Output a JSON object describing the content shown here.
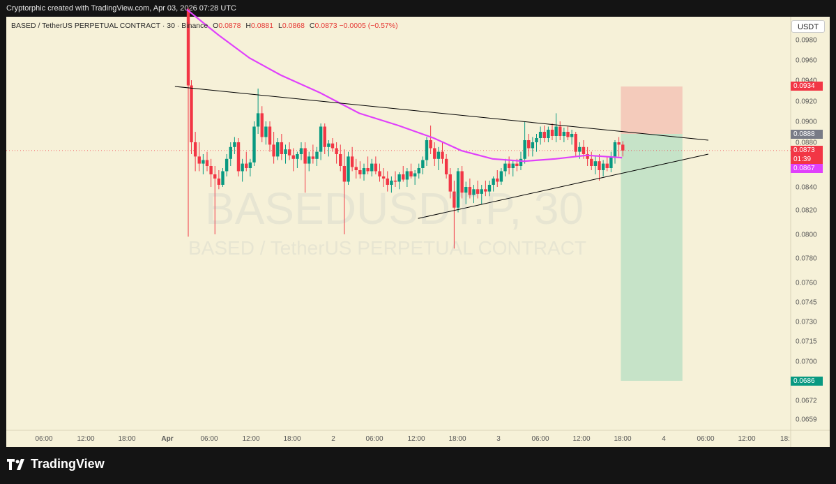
{
  "header": {
    "attribution": "Cryptorphic created with TradingView.com, Apr 03, 2026 07:28 UTC"
  },
  "legend": {
    "symbol": "BASED / TetherUS PERPETUAL CONTRACT · 30 · Binance",
    "o_label": "O",
    "o_value": "0.0878",
    "h_label": "H",
    "h_value": "0.0881",
    "l_label": "L",
    "l_value": "0.0868",
    "c_label": "C",
    "c_value": "0.0873",
    "change": "−0.0005 (−0.57%)"
  },
  "watermark": {
    "ticker": "BASEDUSDT.P, 30",
    "name": "BASED / TetherUS PERPETUAL CONTRACT"
  },
  "currency_button": "USDT",
  "price_tags": {
    "stop": {
      "text": "0.0934",
      "color": "#f23645"
    },
    "entry": {
      "text": "0.0888",
      "color": "#787b86"
    },
    "last": {
      "text": "0.0873",
      "color": "#f23645"
    },
    "countdown": {
      "text": "01:39",
      "color": "#f23645"
    },
    "ma": {
      "text": "0.0867",
      "color": "#e040fb"
    },
    "target": {
      "text": "0.0686",
      "color": "#089981"
    }
  },
  "brand": {
    "name": "TradingView"
  },
  "chart_data": {
    "type": "candlestick",
    "interval": "30",
    "yaxis_ticks": [
      "0.0980",
      "0.0960",
      "0.0940",
      "0.0920",
      "0.0900",
      "0.0880",
      "0.0860",
      "0.0840",
      "0.0820",
      "0.0800",
      "0.0780",
      "0.0760",
      "0.0745",
      "0.0730",
      "0.0715",
      "0.0700",
      "0.0672",
      "0.0659"
    ],
    "xaxis_ticks": [
      "06:00",
      "12:00",
      "18:00",
      "Apr",
      "06:00",
      "12:00",
      "18:00",
      "2",
      "06:00",
      "12:00",
      "18:00",
      "3",
      "06:00",
      "12:00",
      "18:00",
      "4",
      "06:00",
      "12:00",
      "18:"
    ],
    "colors": {
      "up": "#089981",
      "down": "#f23645",
      "ma": "#e040fb",
      "trendline": "#000000",
      "profit_zone": "#c6e3c8",
      "loss_zone": "#f4cbbb"
    },
    "ma_line": [
      [
        0.23,
        0.101
      ],
      [
        0.27,
        0.0985
      ],
      [
        0.31,
        0.0962
      ],
      [
        0.35,
        0.0945
      ],
      [
        0.4,
        0.0928
      ],
      [
        0.45,
        0.0908
      ],
      [
        0.5,
        0.0896
      ],
      [
        0.545,
        0.0884
      ],
      [
        0.58,
        0.0873
      ],
      [
        0.62,
        0.0866
      ],
      [
        0.66,
        0.0864
      ],
      [
        0.7,
        0.0866
      ],
      [
        0.74,
        0.0869
      ],
      [
        0.785,
        0.0867
      ]
    ],
    "trendline_upper": {
      "from": [
        0.215,
        0.0934
      ],
      "to": [
        0.895,
        0.0882
      ]
    },
    "trendline_lower": {
      "from": [
        0.525,
        0.0813
      ],
      "to": [
        0.895,
        0.087
      ]
    },
    "position": {
      "type": "long",
      "entry": 0.0888,
      "stop": 0.0934,
      "target": 0.0686
    },
    "candles": [
      [
        0.232,
        0.101,
        0.1012,
        0.0798,
        0.0935
      ],
      [
        0.236,
        0.0935,
        0.094,
        0.087,
        0.088
      ],
      [
        0.241,
        0.088,
        0.089,
        0.0855,
        0.0868
      ],
      [
        0.246,
        0.0868,
        0.088,
        0.0855,
        0.0862
      ],
      [
        0.251,
        0.0862,
        0.087,
        0.0852,
        0.0865
      ],
      [
        0.256,
        0.0865,
        0.0872,
        0.0855,
        0.086
      ],
      [
        0.261,
        0.086,
        0.0866,
        0.084,
        0.0852
      ],
      [
        0.266,
        0.0852,
        0.086,
        0.08,
        0.0848
      ],
      [
        0.271,
        0.0848,
        0.0856,
        0.0838,
        0.0842
      ],
      [
        0.276,
        0.0842,
        0.0858,
        0.084,
        0.0855
      ],
      [
        0.281,
        0.0855,
        0.087,
        0.085,
        0.0866
      ],
      [
        0.286,
        0.0866,
        0.088,
        0.086,
        0.0876
      ],
      [
        0.291,
        0.0876,
        0.0885,
        0.087,
        0.088
      ],
      [
        0.296,
        0.088,
        0.0884,
        0.085,
        0.0855
      ],
      [
        0.301,
        0.0855,
        0.0866,
        0.0845,
        0.0862
      ],
      [
        0.306,
        0.0862,
        0.0872,
        0.0855,
        0.0858
      ],
      [
        0.311,
        0.0858,
        0.0866,
        0.085,
        0.0863
      ],
      [
        0.316,
        0.0863,
        0.09,
        0.086,
        0.0895
      ],
      [
        0.321,
        0.0895,
        0.0932,
        0.0888,
        0.0908
      ],
      [
        0.326,
        0.0908,
        0.0915,
        0.088,
        0.0885
      ],
      [
        0.331,
        0.0885,
        0.09,
        0.0878,
        0.0895
      ],
      [
        0.336,
        0.0895,
        0.09,
        0.0872,
        0.0878
      ],
      [
        0.341,
        0.0878,
        0.089,
        0.0862,
        0.0868
      ],
      [
        0.346,
        0.0868,
        0.0884,
        0.0865,
        0.088
      ],
      [
        0.351,
        0.088,
        0.0888,
        0.0865,
        0.087
      ],
      [
        0.356,
        0.087,
        0.0878,
        0.0862,
        0.0874
      ],
      [
        0.361,
        0.0874,
        0.088,
        0.0865,
        0.0869
      ],
      [
        0.366,
        0.0869,
        0.0875,
        0.0855,
        0.0866
      ],
      [
        0.371,
        0.0866,
        0.0872,
        0.0858,
        0.087
      ],
      [
        0.376,
        0.087,
        0.088,
        0.0865,
        0.0875
      ],
      [
        0.381,
        0.0875,
        0.088,
        0.0835,
        0.0862
      ],
      [
        0.386,
        0.0862,
        0.0872,
        0.0855,
        0.0868
      ],
      [
        0.391,
        0.0868,
        0.0878,
        0.0862,
        0.0866
      ],
      [
        0.396,
        0.0866,
        0.0876,
        0.086,
        0.0872
      ],
      [
        0.401,
        0.0872,
        0.0898,
        0.0865,
        0.0895
      ],
      [
        0.406,
        0.0895,
        0.0898,
        0.087,
        0.0876
      ],
      [
        0.411,
        0.0876,
        0.0882,
        0.0868,
        0.0879
      ],
      [
        0.416,
        0.0879,
        0.0884,
        0.0872,
        0.0875
      ],
      [
        0.421,
        0.0875,
        0.088,
        0.0862,
        0.087
      ],
      [
        0.426,
        0.087,
        0.0878,
        0.0855,
        0.086
      ],
      [
        0.431,
        0.086,
        0.0874,
        0.08,
        0.0845
      ],
      [
        0.436,
        0.0845,
        0.0872,
        0.0842,
        0.0868
      ],
      [
        0.441,
        0.0868,
        0.0876,
        0.0855,
        0.0859
      ],
      [
        0.446,
        0.0859,
        0.0866,
        0.0848,
        0.0856
      ],
      [
        0.451,
        0.0856,
        0.0864,
        0.0848,
        0.0852
      ],
      [
        0.456,
        0.0852,
        0.0862,
        0.0846,
        0.0858
      ],
      [
        0.461,
        0.0858,
        0.0868,
        0.0852,
        0.0855
      ],
      [
        0.466,
        0.0855,
        0.0866,
        0.085,
        0.0862
      ],
      [
        0.471,
        0.0862,
        0.0868,
        0.0852,
        0.0855
      ],
      [
        0.476,
        0.0855,
        0.0862,
        0.0845,
        0.085
      ],
      [
        0.481,
        0.085,
        0.0858,
        0.084,
        0.0848
      ],
      [
        0.486,
        0.0848,
        0.0855,
        0.0836,
        0.0842
      ],
      [
        0.491,
        0.0842,
        0.085,
        0.0835,
        0.0846
      ],
      [
        0.496,
        0.0846,
        0.0855,
        0.084,
        0.0845
      ],
      [
        0.501,
        0.0845,
        0.0854,
        0.0838,
        0.0852
      ],
      [
        0.506,
        0.0852,
        0.086,
        0.0845,
        0.0847
      ],
      [
        0.511,
        0.0847,
        0.0858,
        0.084,
        0.0855
      ],
      [
        0.516,
        0.0855,
        0.0862,
        0.0848,
        0.085
      ],
      [
        0.521,
        0.085,
        0.0856,
        0.0842,
        0.0853
      ],
      [
        0.526,
        0.0853,
        0.0862,
        0.0848,
        0.0858
      ],
      [
        0.531,
        0.0858,
        0.0868,
        0.0852,
        0.0865
      ],
      [
        0.536,
        0.0865,
        0.0885,
        0.086,
        0.0882
      ],
      [
        0.541,
        0.0882,
        0.0896,
        0.087,
        0.0875
      ],
      [
        0.546,
        0.0875,
        0.088,
        0.086,
        0.0866
      ],
      [
        0.551,
        0.0866,
        0.0876,
        0.0856,
        0.0872
      ],
      [
        0.556,
        0.0872,
        0.088,
        0.0862,
        0.0866
      ],
      [
        0.561,
        0.0866,
        0.087,
        0.0848,
        0.0852
      ],
      [
        0.566,
        0.0852,
        0.0858,
        0.083,
        0.0836
      ],
      [
        0.571,
        0.0836,
        0.0846,
        0.0788,
        0.0822
      ],
      [
        0.576,
        0.0822,
        0.0858,
        0.0818,
        0.0855
      ],
      [
        0.581,
        0.0855,
        0.086,
        0.083,
        0.0835
      ],
      [
        0.586,
        0.0835,
        0.0845,
        0.0825,
        0.084
      ],
      [
        0.591,
        0.084,
        0.0848,
        0.083,
        0.0833
      ],
      [
        0.596,
        0.0833,
        0.0842,
        0.0826,
        0.0838
      ],
      [
        0.601,
        0.0838,
        0.0846,
        0.083,
        0.0834
      ],
      [
        0.606,
        0.0834,
        0.0842,
        0.0825,
        0.0838
      ],
      [
        0.611,
        0.0838,
        0.0846,
        0.0832,
        0.0836
      ],
      [
        0.616,
        0.0836,
        0.0846,
        0.0832,
        0.0842
      ],
      [
        0.621,
        0.0842,
        0.085,
        0.0836,
        0.0848
      ],
      [
        0.626,
        0.0848,
        0.0856,
        0.084,
        0.0845
      ],
      [
        0.631,
        0.0845,
        0.0858,
        0.0842,
        0.0855
      ],
      [
        0.636,
        0.0855,
        0.0866,
        0.085,
        0.0862
      ],
      [
        0.641,
        0.0862,
        0.0868,
        0.0852,
        0.0858
      ],
      [
        0.646,
        0.0858,
        0.0865,
        0.085,
        0.0862
      ],
      [
        0.651,
        0.0862,
        0.0866,
        0.0855,
        0.086
      ],
      [
        0.656,
        0.086,
        0.0872,
        0.0856,
        0.0866
      ],
      [
        0.661,
        0.0866,
        0.09,
        0.0862,
        0.0882
      ],
      [
        0.666,
        0.0882,
        0.0888,
        0.0868,
        0.0875
      ],
      [
        0.671,
        0.0875,
        0.0885,
        0.0868,
        0.088
      ],
      [
        0.676,
        0.088,
        0.0888,
        0.0872,
        0.0884
      ],
      [
        0.681,
        0.0884,
        0.0895,
        0.0878,
        0.089
      ],
      [
        0.686,
        0.089,
        0.0896,
        0.088,
        0.0884
      ],
      [
        0.691,
        0.0884,
        0.0895,
        0.088,
        0.0892
      ],
      [
        0.696,
        0.0892,
        0.0898,
        0.0882,
        0.0886
      ],
      [
        0.701,
        0.0886,
        0.0908,
        0.088,
        0.0895
      ],
      [
        0.706,
        0.0895,
        0.09,
        0.0882,
        0.0886
      ],
      [
        0.711,
        0.0886,
        0.0894,
        0.088,
        0.089
      ],
      [
        0.716,
        0.089,
        0.0895,
        0.0882,
        0.0885
      ],
      [
        0.721,
        0.0885,
        0.0892,
        0.0878,
        0.0888
      ],
      [
        0.726,
        0.0888,
        0.089,
        0.0868,
        0.0872
      ],
      [
        0.731,
        0.0872,
        0.088,
        0.0866,
        0.0876
      ],
      [
        0.736,
        0.0876,
        0.0882,
        0.0866,
        0.087
      ],
      [
        0.741,
        0.087,
        0.0876,
        0.086,
        0.0866
      ],
      [
        0.746,
        0.0866,
        0.0872,
        0.0856,
        0.086
      ],
      [
        0.751,
        0.086,
        0.0868,
        0.0852,
        0.0864
      ],
      [
        0.756,
        0.0864,
        0.087,
        0.0846,
        0.0856
      ],
      [
        0.761,
        0.0856,
        0.0865,
        0.085,
        0.0862
      ],
      [
        0.766,
        0.0862,
        0.0868,
        0.0855,
        0.0858
      ],
      [
        0.771,
        0.0858,
        0.0872,
        0.0854,
        0.0868
      ],
      [
        0.776,
        0.0868,
        0.0882,
        0.0862,
        0.088
      ],
      [
        0.781,
        0.088,
        0.0885,
        0.0868,
        0.0878
      ],
      [
        0.786,
        0.0878,
        0.0881,
        0.0868,
        0.0873
      ]
    ]
  }
}
